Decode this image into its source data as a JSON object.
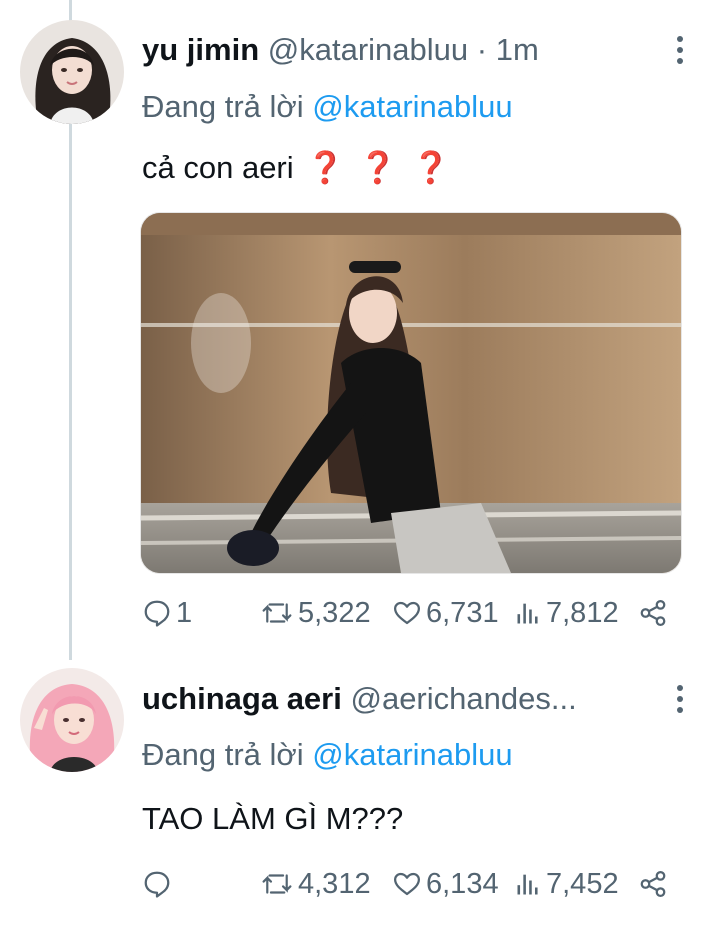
{
  "colors": {
    "accent": "#1d9bf0",
    "secondary_text": "#536471",
    "primary_text": "#0f1419",
    "thread_line": "#cfd9de",
    "emoji_red": "#e0232f"
  },
  "tweets": [
    {
      "name": "yu jimin",
      "handle": "@katarinabluu",
      "separator": "·",
      "time": "1m",
      "reply_prefix": "Đang trả lời",
      "reply_to": "@katarinabluu",
      "text": "cả con aeri",
      "emoji": "❓❓❓",
      "has_media": true,
      "stats": {
        "replies": "1",
        "retweets": "5,322",
        "likes": "6,731",
        "views": "7,812"
      }
    },
    {
      "name": "uchinaga aeri",
      "handle": "@aerichandes...",
      "reply_prefix": "Đang trả lời",
      "reply_to": "@katarinabluu",
      "text": "TAO LÀM GÌ M???",
      "stats": {
        "replies": "",
        "retweets": "4,312",
        "likes": "6,134",
        "views": "7,452"
      }
    }
  ],
  "icons": {
    "reply": "reply-icon",
    "retweet": "retweet-icon",
    "like": "heart-icon",
    "views": "views-icon",
    "share": "share-icon",
    "more": "more-vertical-icon"
  }
}
